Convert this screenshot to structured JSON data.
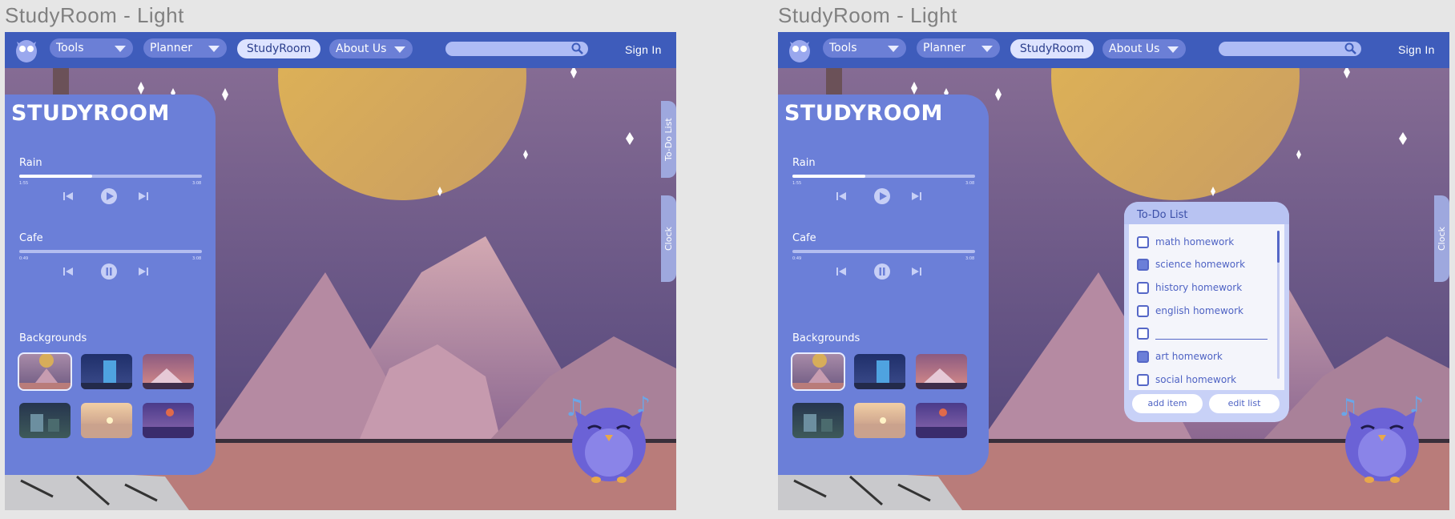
{
  "figure": {
    "left_title": "StudyRoom - Light",
    "right_title": "StudyRoom - Light"
  },
  "nav": {
    "tools_label": "Tools",
    "planner_label": "Planner",
    "studyroom_label": "StudyRoom",
    "about_label": "About Us",
    "sign_in_label": "Sign In",
    "search_placeholder": ""
  },
  "panel": {
    "title": "STUDYROOM",
    "tracks": [
      {
        "name": "Rain",
        "elapsed": "1:55",
        "total": "3:08",
        "progress": 0.4,
        "state": "paused"
      },
      {
        "name": "Cafe",
        "elapsed": "0:49",
        "total": "3:08",
        "progress": 0.0,
        "state": "playing"
      }
    ],
    "backgrounds_label": "Backgrounds"
  },
  "tabs": {
    "todo_label": "To-Do List",
    "clock_label": "Clock"
  },
  "todo": {
    "title": "To-Do List",
    "items": [
      {
        "label": "math homework",
        "checked": false
      },
      {
        "label": "science homework",
        "checked": true
      },
      {
        "label": "history homework",
        "checked": false
      },
      {
        "label": "english homework",
        "checked": false
      },
      {
        "label": "",
        "checked": false
      },
      {
        "label": "art homework",
        "checked": true
      },
      {
        "label": "social homework",
        "checked": false
      }
    ],
    "add_label": "add item",
    "edit_label": "edit list"
  },
  "colors": {
    "nav": "#3e5cbb",
    "panel": "#6b7fd8",
    "sky_top": "#8a6f96",
    "sky_bottom": "#5a4a7e",
    "moon": "#d9ab58",
    "floor": "#b97c7a"
  }
}
